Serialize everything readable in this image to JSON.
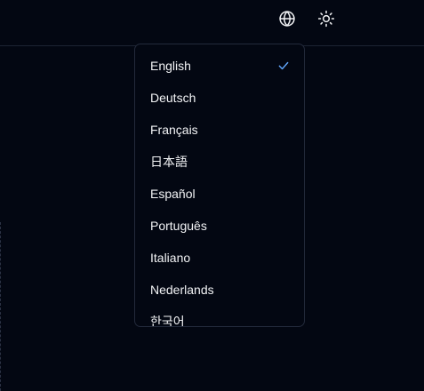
{
  "header": {
    "language_button_icon": "globe-icon",
    "theme_button_icon": "sun-icon"
  },
  "language_menu": {
    "selected": "English",
    "items": [
      {
        "label": "English"
      },
      {
        "label": "Deutsch"
      },
      {
        "label": "Français"
      },
      {
        "label": "日本語"
      },
      {
        "label": "Español"
      },
      {
        "label": "Português"
      },
      {
        "label": "Italiano"
      },
      {
        "label": "Nederlands"
      },
      {
        "label": "한국어"
      }
    ]
  },
  "colors": {
    "background": "#030712",
    "border": "#232a3b",
    "text": "#f3f4f6",
    "check": "#60a5fa"
  }
}
